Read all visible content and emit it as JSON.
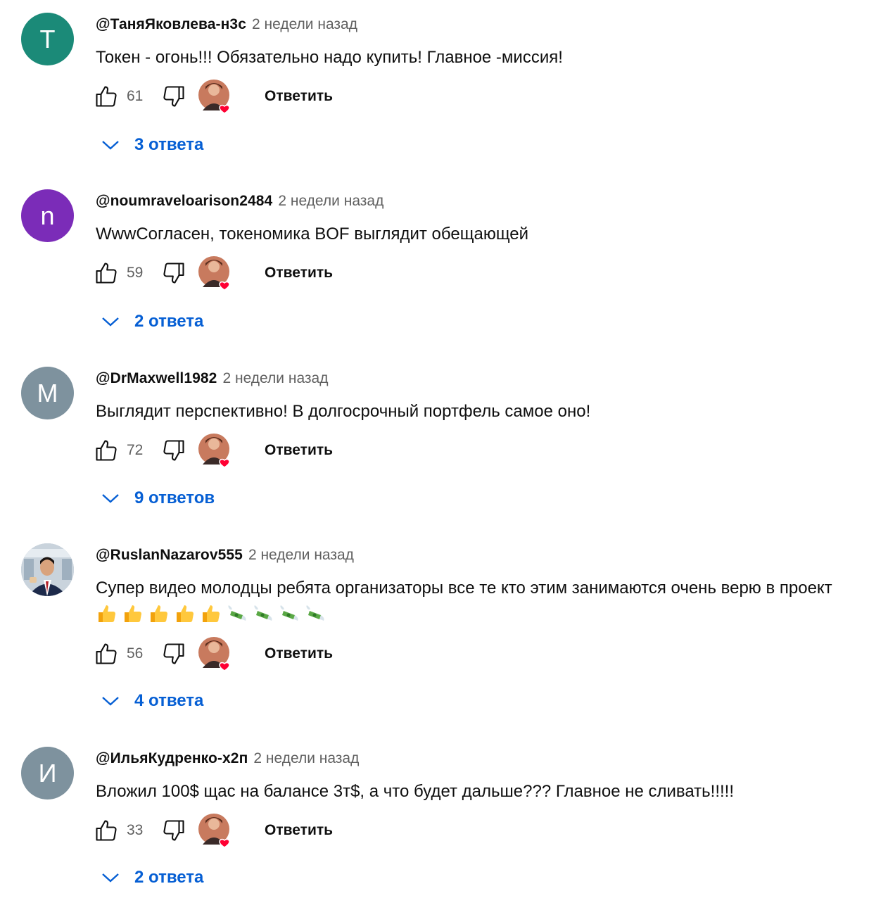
{
  "comments": [
    {
      "author": "@ТаняЯковлева-н3с",
      "time": "2 недели назад",
      "avatar_letter": "T",
      "avatar_color": "#1b8a78",
      "text": "Токен - огонь!!! Обязательно надо купить! Главное -миссия!",
      "likes": "61",
      "reply_label": "Ответить",
      "replies_label": "3 ответа"
    },
    {
      "author": "@noumraveloarison2484",
      "time": "2 недели назад",
      "avatar_letter": "n",
      "avatar_color": "#7b2cb8",
      "text": "WwwСогласен, токеномика BOF выглядит обещающей",
      "likes": "59",
      "reply_label": "Ответить",
      "replies_label": "2 ответа"
    },
    {
      "author": "@DrMaxwell1982",
      "time": "2 недели назад",
      "avatar_letter": "M",
      "avatar_color": "#7e929e",
      "text": "Выглядит перспективно! В долгосрочный портфель самое оно!",
      "likes": "72",
      "reply_label": "Ответить",
      "replies_label": "9 ответов"
    },
    {
      "author": "@RuslanNazarov555",
      "time": "2 недели назад",
      "avatar_letter": "",
      "avatar_color": "#bcc8d4",
      "text": "Супер видео молодцы ребята организаторы все те кто этим занимаются очень верю в проект",
      "emojis": [
        "thumbs-up",
        "thumbs-up",
        "thumbs-up",
        "thumbs-up",
        "thumbs-up",
        "money-with-wings",
        "money-with-wings",
        "money-with-wings",
        "money-with-wings"
      ],
      "likes": "56",
      "reply_label": "Ответить",
      "replies_label": "4 ответа"
    },
    {
      "author": "@ИльяКудренко-х2п",
      "time": "2 недели назад",
      "avatar_letter": "И",
      "avatar_color": "#7e929e",
      "text": "Вложил 100$ щас на балансе 3т$, а что будет дальше??? Главное не сливать!!!!!",
      "likes": "33",
      "reply_label": "Ответить",
      "replies_label": "2 ответа"
    }
  ],
  "colors": {
    "link_blue": "#065fd4",
    "muted_text": "#606060",
    "heart_red": "#ff0033"
  },
  "icons": [
    "like-icon",
    "dislike-icon",
    "creator-heart-icon",
    "chevron-down-icon"
  ]
}
